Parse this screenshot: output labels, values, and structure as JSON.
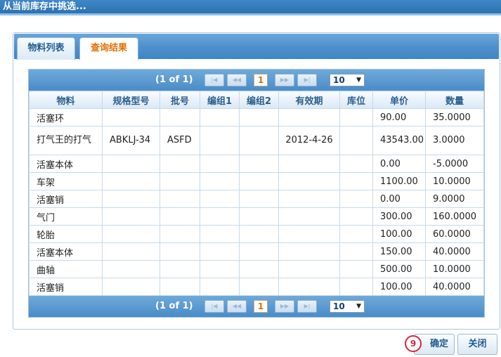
{
  "title": "从当前库存中挑选...",
  "tabs": [
    {
      "label": "物料列表"
    },
    {
      "label": "查询结果"
    }
  ],
  "pager": {
    "info": "(1 of 1)",
    "first": "|◀",
    "prev": "◀◀",
    "page": "1",
    "next": "▶▶",
    "last": "▶|",
    "size": "10"
  },
  "columns": [
    "物料",
    "规格型号",
    "批号",
    "编组1",
    "编组2",
    "有效期",
    "库位",
    "单价",
    "数量"
  ],
  "rows": [
    [
      "活塞环",
      "",
      "",
      "",
      "",
      "",
      "",
      "90.00",
      "35.0000"
    ],
    [
      "打气王的打气",
      "ABKLJ-34",
      "ASFD",
      "",
      "",
      "2012-4-26",
      "",
      "43543.00",
      "3.0000"
    ],
    [
      "活塞本体",
      "",
      "",
      "",
      "",
      "",
      "",
      "0.00",
      "-5.0000"
    ],
    [
      "车架",
      "",
      "",
      "",
      "",
      "",
      "",
      "1100.00",
      "10.0000"
    ],
    [
      "活塞销",
      "",
      "",
      "",
      "",
      "",
      "",
      "0.00",
      "9.0000"
    ],
    [
      "气门",
      "",
      "",
      "",
      "",
      "",
      "",
      "300.00",
      "160.0000"
    ],
    [
      "轮胎",
      "",
      "",
      "",
      "",
      "",
      "",
      "100.00",
      "60.0000"
    ],
    [
      "活塞本体",
      "",
      "",
      "",
      "",
      "",
      "",
      "150.00",
      "40.0000"
    ],
    [
      "曲轴",
      "",
      "",
      "",
      "",
      "",
      "",
      "500.00",
      "10.0000"
    ],
    [
      "活塞销",
      "",
      "",
      "",
      "",
      "",
      "",
      "100.00",
      "40.0000"
    ]
  ],
  "buttons": {
    "confirm": "确定",
    "close": "关闭"
  },
  "badge": "9",
  "colors": {
    "accent": "#3f86c6",
    "active_tab_text": "#e07000",
    "badge": "#d7263d"
  }
}
